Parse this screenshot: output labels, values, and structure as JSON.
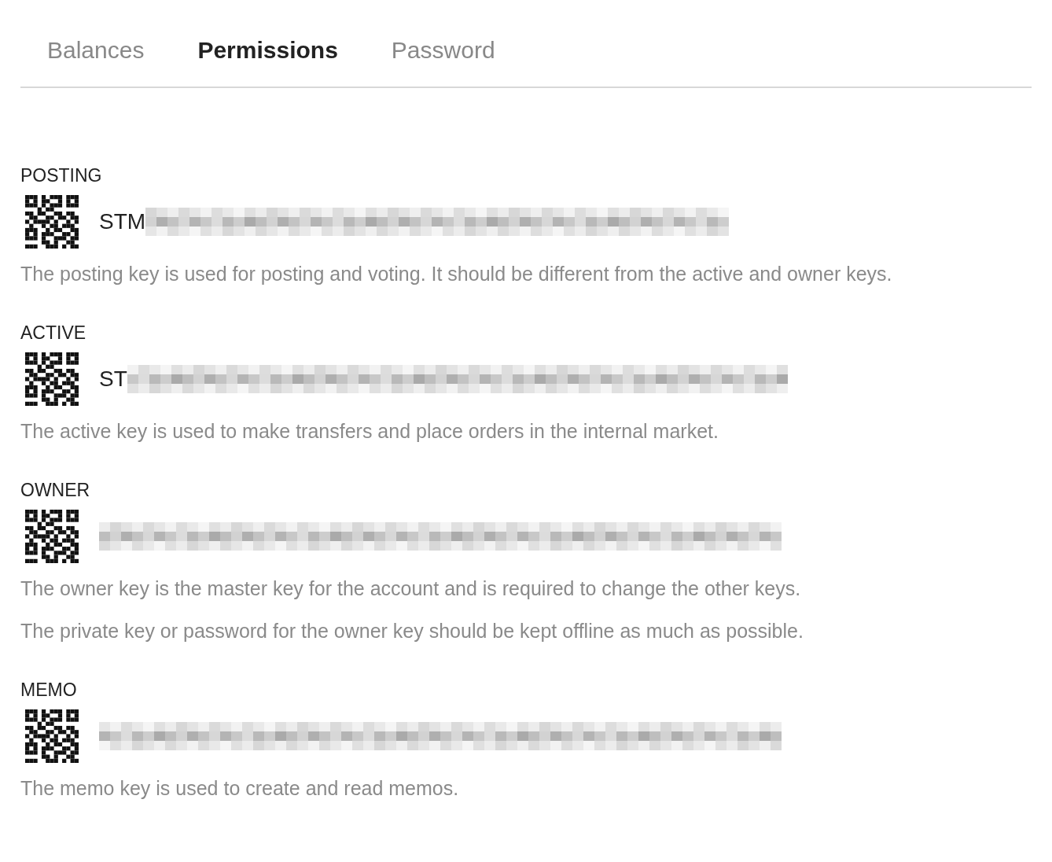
{
  "tabs": [
    {
      "label": "Balances",
      "selected": false
    },
    {
      "label": "Permissions",
      "selected": true
    },
    {
      "label": "Password",
      "selected": false
    }
  ],
  "keys": [
    {
      "label": "POSTING",
      "key_prefix": "STM",
      "descriptions": [
        "The posting key is used for posting and voting. It should be different from the active and owner keys."
      ]
    },
    {
      "label": "ACTIVE",
      "key_prefix": "ST",
      "descriptions": [
        "The active key is used to make transfers and place orders in the internal market."
      ]
    },
    {
      "label": "OWNER",
      "descriptions": [
        "The owner key is the master key for the account and is required to change the other keys.",
        "The private key or password for the owner key should be kept offline as much as possible."
      ]
    },
    {
      "label": "MEMO",
      "descriptions": [
        "The memo key is used to create and read memos."
      ]
    }
  ]
}
